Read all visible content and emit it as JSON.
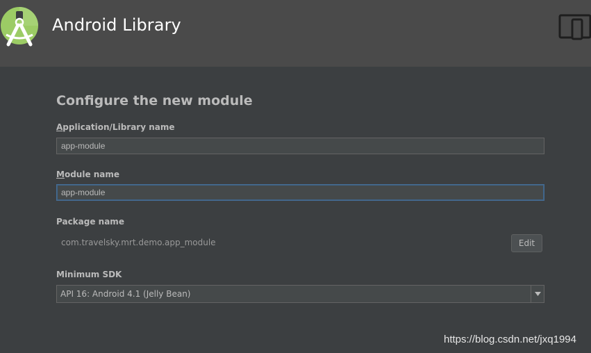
{
  "header": {
    "title": "Android Library"
  },
  "form": {
    "section_title": "Configure the new module",
    "app_name": {
      "label_mnemonic": "A",
      "label_rest": "pplication/Library name",
      "value": "app-module"
    },
    "module_name": {
      "label_mnemonic": "M",
      "label_rest": "odule name",
      "value": "app-module"
    },
    "package_name": {
      "label": "Package name",
      "value": "com.travelsky.mrt.demo.app_module",
      "edit_label": "Edit"
    },
    "min_sdk": {
      "label": "Minimum SDK",
      "selected": "API 16: Android 4.1 (Jelly Bean)"
    }
  },
  "watermark": "https://blog.csdn.net/jxq1994",
  "colors": {
    "header_bg": "#4a4a4a",
    "content_bg": "#3c3f41",
    "android_green": "#9ccc65",
    "focus_border": "#466d94"
  },
  "icons": {
    "logo": "android-studio-logo-icon",
    "device": "device-layout-icon",
    "dropdown": "chevron-down-icon"
  }
}
